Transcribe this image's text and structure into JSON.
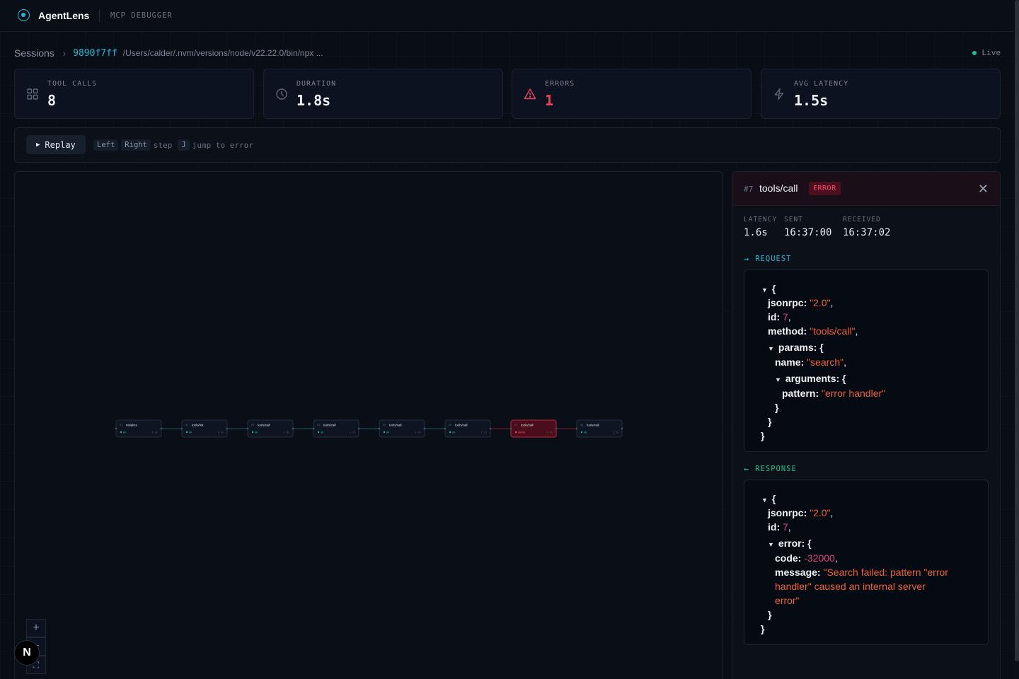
{
  "app": {
    "name": "AgentLens",
    "subtitle": "MCP DEBUGGER"
  },
  "breadcrumb": {
    "sessions": "Sessions",
    "session_id": "9890f7ff",
    "path": "/Users/calder/.nvm/versions/node/v22.22.0/bin/npx ..."
  },
  "status": {
    "live": "Live"
  },
  "stats": [
    {
      "label": "TOOL CALLS",
      "value": "8",
      "icon": "grid-icon"
    },
    {
      "label": "DURATION",
      "value": "1.8s",
      "icon": "clock-icon"
    },
    {
      "label": "ERRORS",
      "value": "1",
      "icon": "warning-icon"
    },
    {
      "label": "AVG LATENCY",
      "value": "1.5s",
      "icon": "lightning-icon"
    }
  ],
  "replay": {
    "button": "Replay",
    "keys": [
      "Left",
      "Right",
      "J"
    ],
    "hints": [
      "step",
      "jump to error"
    ]
  },
  "flow": {
    "nodes": [
      {
        "num": "#1",
        "method": "initialize",
        "status": "OK",
        "latency": "1.3s",
        "error": false
      },
      {
        "num": "#2",
        "method": "tools/list",
        "status": "OK",
        "latency": "1.3s",
        "error": false
      },
      {
        "num": "#3",
        "method": "tools/call",
        "status": "OK",
        "latency": "1.4s",
        "error": false
      },
      {
        "num": "#4",
        "method": "tools/call",
        "status": "OK",
        "latency": "1.7s",
        "error": false
      },
      {
        "num": "#5",
        "method": "tools/call",
        "status": "OK",
        "latency": "1.4s",
        "error": false
      },
      {
        "num": "#6",
        "method": "tools/call",
        "status": "OK",
        "latency": "1.7s",
        "error": false
      },
      {
        "num": "#7",
        "method": "tools/call",
        "status": "ERROR",
        "latency": "1.6s",
        "error": true
      },
      {
        "num": "#8",
        "method": "tools/call",
        "status": "OK",
        "latency": "1.5s",
        "error": false
      }
    ],
    "zoom": {
      "in": "+",
      "out": "−",
      "fit": "⛶"
    }
  },
  "badge": {
    "letter": "N"
  },
  "detail": {
    "num": "#7",
    "method": "tools/call",
    "badge": "ERROR",
    "close": "✕",
    "meta": [
      {
        "label": "LATENCY",
        "value": "1.6s"
      },
      {
        "label": "SENT",
        "value": "16:37:00"
      },
      {
        "label": "RECEIVED",
        "value": "16:37:02"
      }
    ],
    "request_title": "REQUEST",
    "response_title": "RESPONSE",
    "request": {
      "jsonrpc": "\"2.0\"",
      "id": "7",
      "method": "\"tools/call\"",
      "name": "\"search\"",
      "pattern": "\"error handler\""
    },
    "response": {
      "jsonrpc": "\"2.0\"",
      "id": "7",
      "code": "-32000",
      "message_l1": "\"Search failed: pattern \"error",
      "message_l2": "handler\" caused an internal server",
      "message_l3": "error\""
    },
    "keys": {
      "jsonrpc": "jsonrpc:",
      "id": "id:",
      "method": "method:",
      "params": "params:",
      "name": "name:",
      "arguments": "arguments:",
      "pattern": "pattern:",
      "error": "error:",
      "code": "code:",
      "message": "message:"
    }
  },
  "colors": {
    "accent": "#22b8d6",
    "ok": "#1fbf8f",
    "error": "#f0405a"
  }
}
